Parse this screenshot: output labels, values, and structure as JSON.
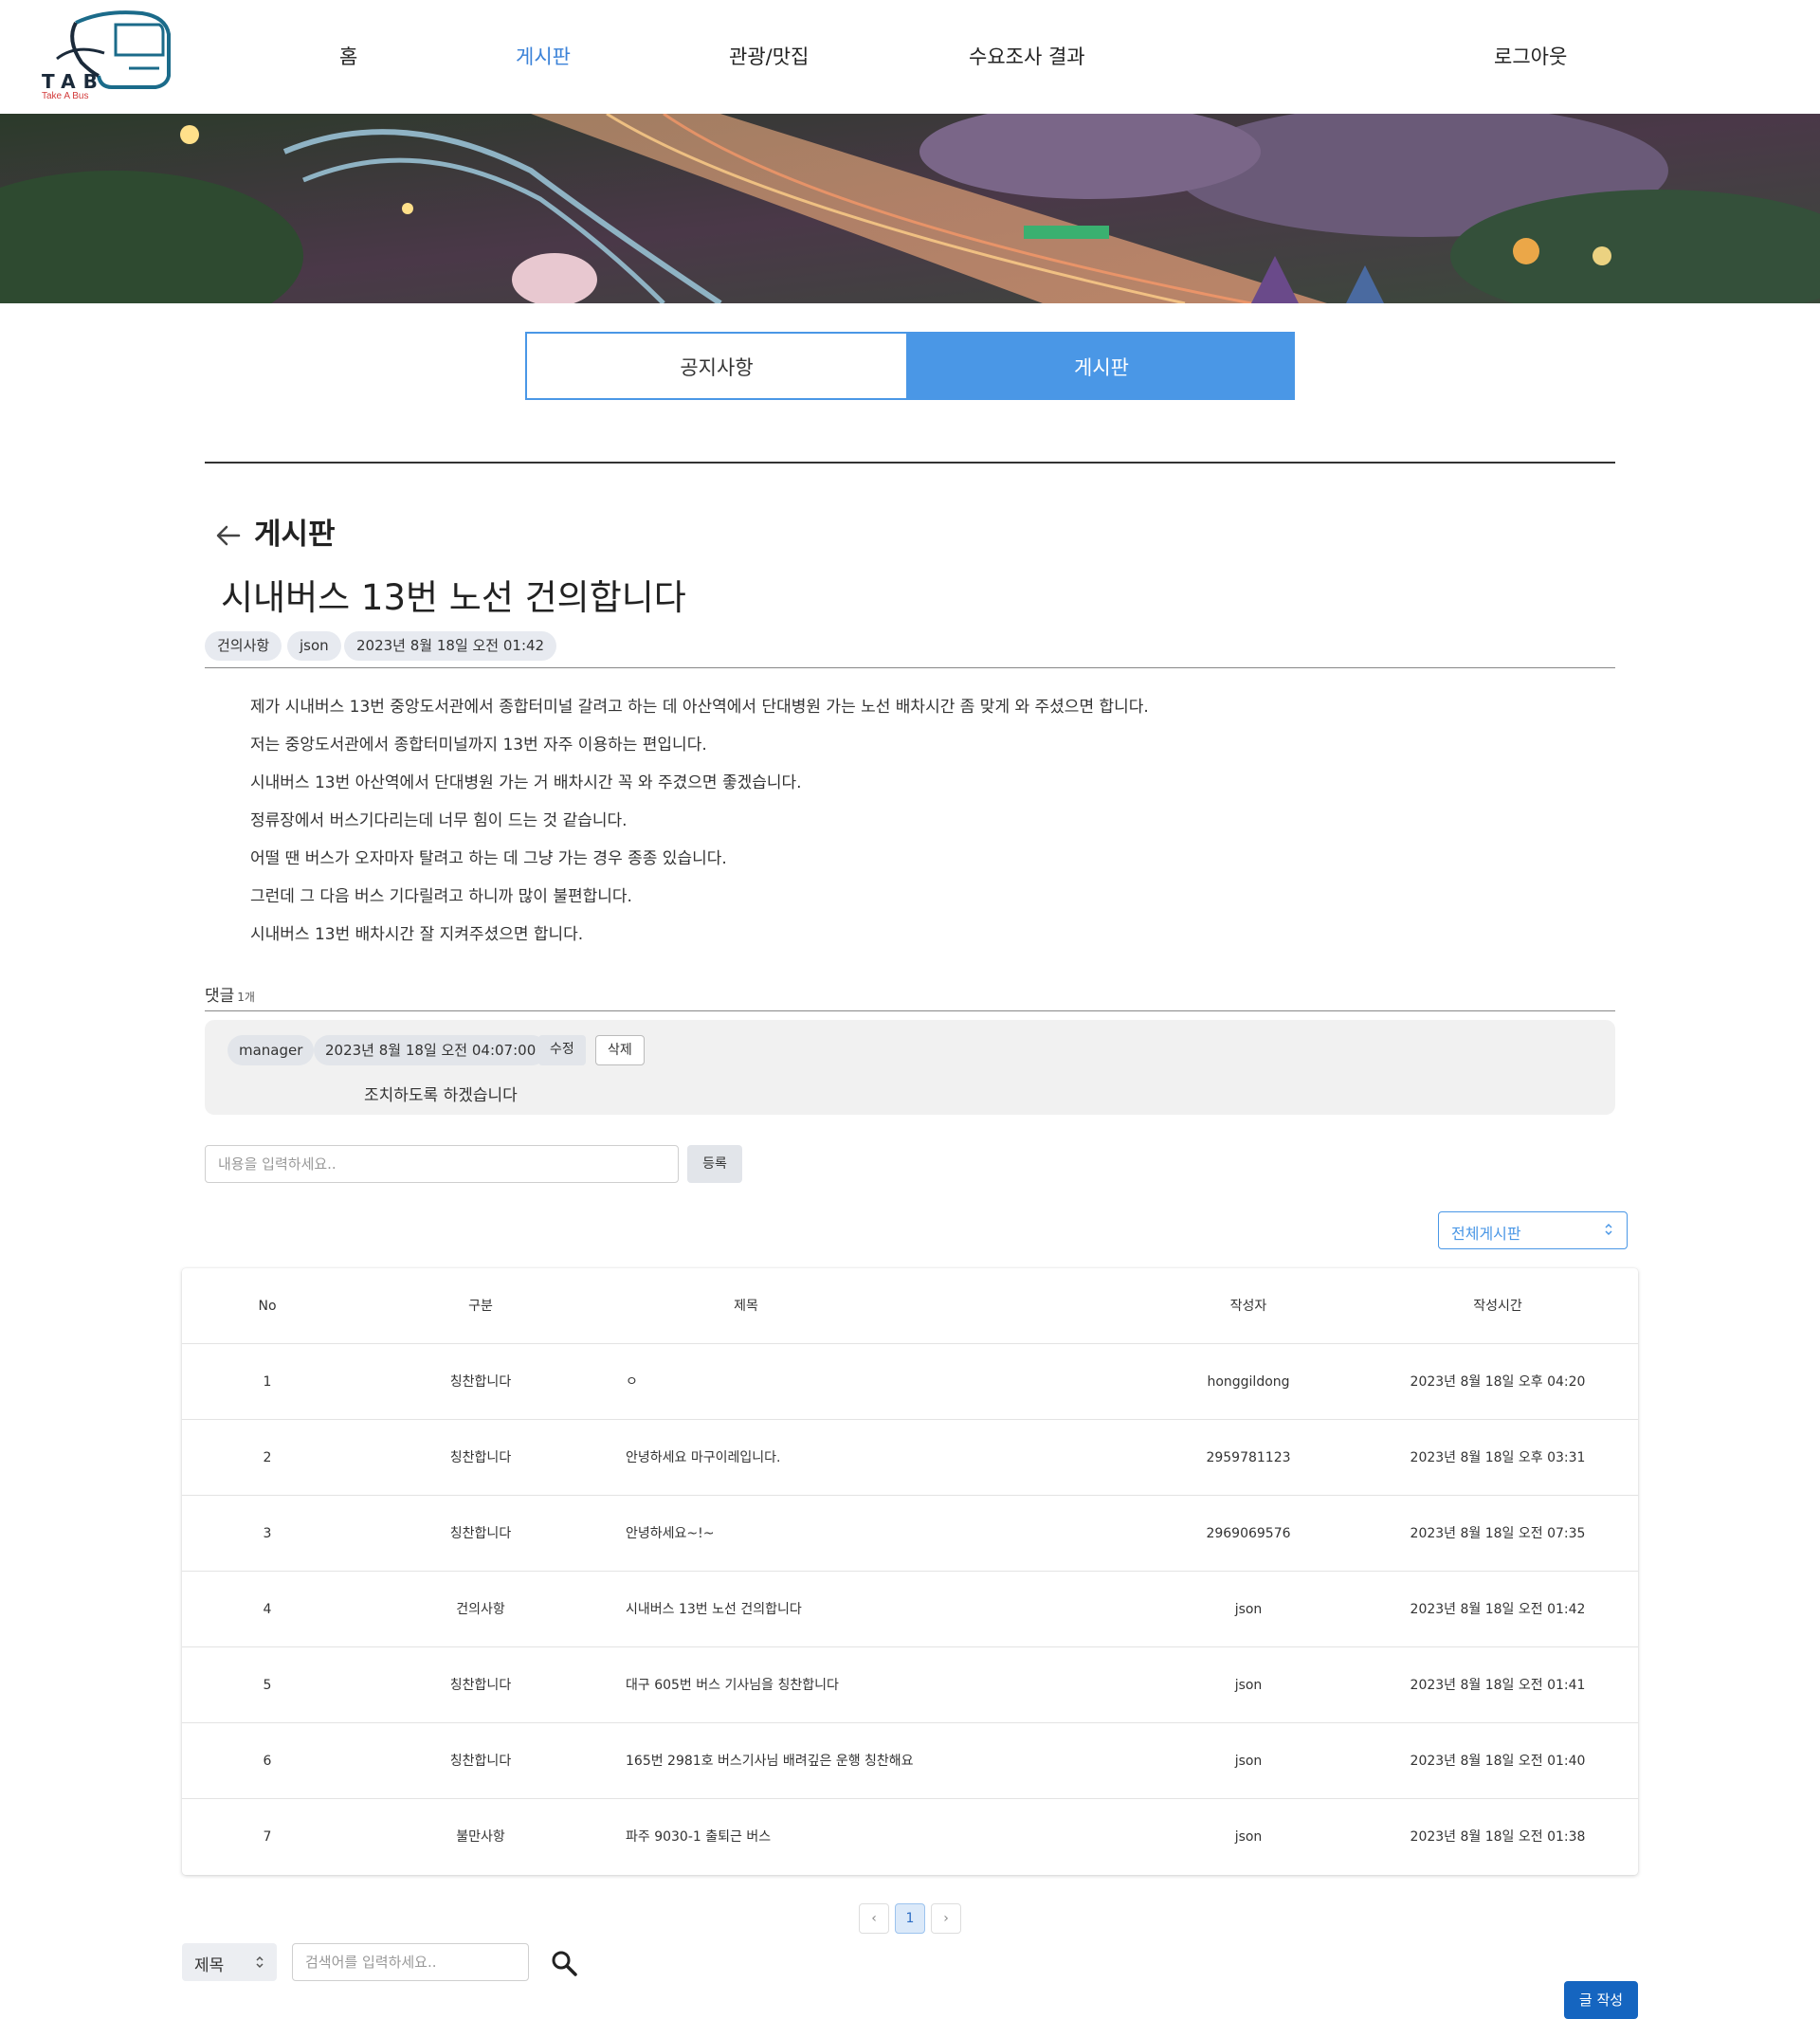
{
  "header": {
    "logo_text": "TAB",
    "logo_subtext": "Take A Bus",
    "nav": [
      {
        "label": "홈"
      },
      {
        "label": "게시판"
      },
      {
        "label": "관광/맛집"
      },
      {
        "label": "수요조사 결과"
      },
      {
        "label": "로그아웃"
      }
    ],
    "active_nav": "게시판"
  },
  "tabs": [
    {
      "label": "공지사항",
      "active": false
    },
    {
      "label": "게시판",
      "active": true
    }
  ],
  "post": {
    "board_label": "게시판",
    "title": "시내버스 13번 노선 건의합니다",
    "category": "건의사항",
    "author": "json",
    "date": "2023년 8월 18일 오전 01:42",
    "body": [
      "제가 시내버스 13번 중앙도서관에서 종합터미널 갈려고 하는 데 아산역에서 단대병원 가는 노선 배차시간 좀 맞게 와 주셨으면 합니다.",
      "저는 중앙도서관에서 종합터미널까지 13번 자주 이용하는 편입니다.",
      "시내버스 13번 아산역에서 단대병원 가는 거 배차시간 꼭 와 주겼으면 좋겠습니다.",
      "정류장에서 버스기다리는데 너무 힘이 드는 것 같습니다.",
      "어떨 땐 버스가 오자마자 탈려고 하는 데 그냥 가는 경우 종종 있습니다.",
      "그런데 그 다음 버스 기다릴려고 하니까 많이 불편합니다.",
      "시내버스 13번 배차시간 잘 지켜주셨으면 합니다."
    ]
  },
  "comments": {
    "label": "댓글",
    "count": "1개",
    "items": [
      {
        "author": "manager",
        "date": "2023년 8월 18일 오전 04:07:00",
        "edit_label": "수정",
        "delete_label": "삭제",
        "text": "조치하도록 하겠습니다"
      }
    ],
    "input_placeholder": "내용을 입력하세요..",
    "submit_label": "등록"
  },
  "board_filter": {
    "selected": "전체게시판"
  },
  "table": {
    "headers": {
      "no": "No",
      "category": "구분",
      "title": "제목",
      "author": "작성자",
      "time": "작성시간"
    },
    "rows": [
      {
        "no": "1",
        "category": "칭찬합니다",
        "title": "ㅇ",
        "author": "honggildong",
        "time": "2023년 8월 18일 오후 04:20"
      },
      {
        "no": "2",
        "category": "칭찬합니다",
        "title": "안녕하세요 마구이레입니다.",
        "author": "2959781123",
        "time": "2023년 8월 18일 오후 03:31"
      },
      {
        "no": "3",
        "category": "칭찬합니다",
        "title": "안녕하세요~!~",
        "author": "2969069576",
        "time": "2023년 8월 18일 오전 07:35"
      },
      {
        "no": "4",
        "category": "건의사항",
        "title": "시내버스 13번 노선 건의합니다",
        "author": "json",
        "time": "2023년 8월 18일 오전 01:42"
      },
      {
        "no": "5",
        "category": "칭찬합니다",
        "title": "대구 605번 버스 기사님을 칭찬합니다",
        "author": "json",
        "time": "2023년 8월 18일 오전 01:41"
      },
      {
        "no": "6",
        "category": "칭찬합니다",
        "title": "165번 2981호 버스기사님 배려깊은 운행 칭찬해요",
        "author": "json",
        "time": "2023년 8월 18일 오전 01:40"
      },
      {
        "no": "7",
        "category": "불만사항",
        "title": "파주 9030-1 출퇴근 버스",
        "author": "json",
        "time": "2023년 8월 18일 오전 01:38"
      }
    ]
  },
  "pagination": {
    "prev": "‹",
    "current": "1",
    "next": "›"
  },
  "search": {
    "field": "제목",
    "placeholder": "검색어를 입력하세요..",
    "icon": "search-icon"
  },
  "write_label": "글 작성",
  "colors": {
    "accent": "#4a97e6",
    "primary_button": "#1565c0",
    "active_nav": "#3b82d8"
  }
}
